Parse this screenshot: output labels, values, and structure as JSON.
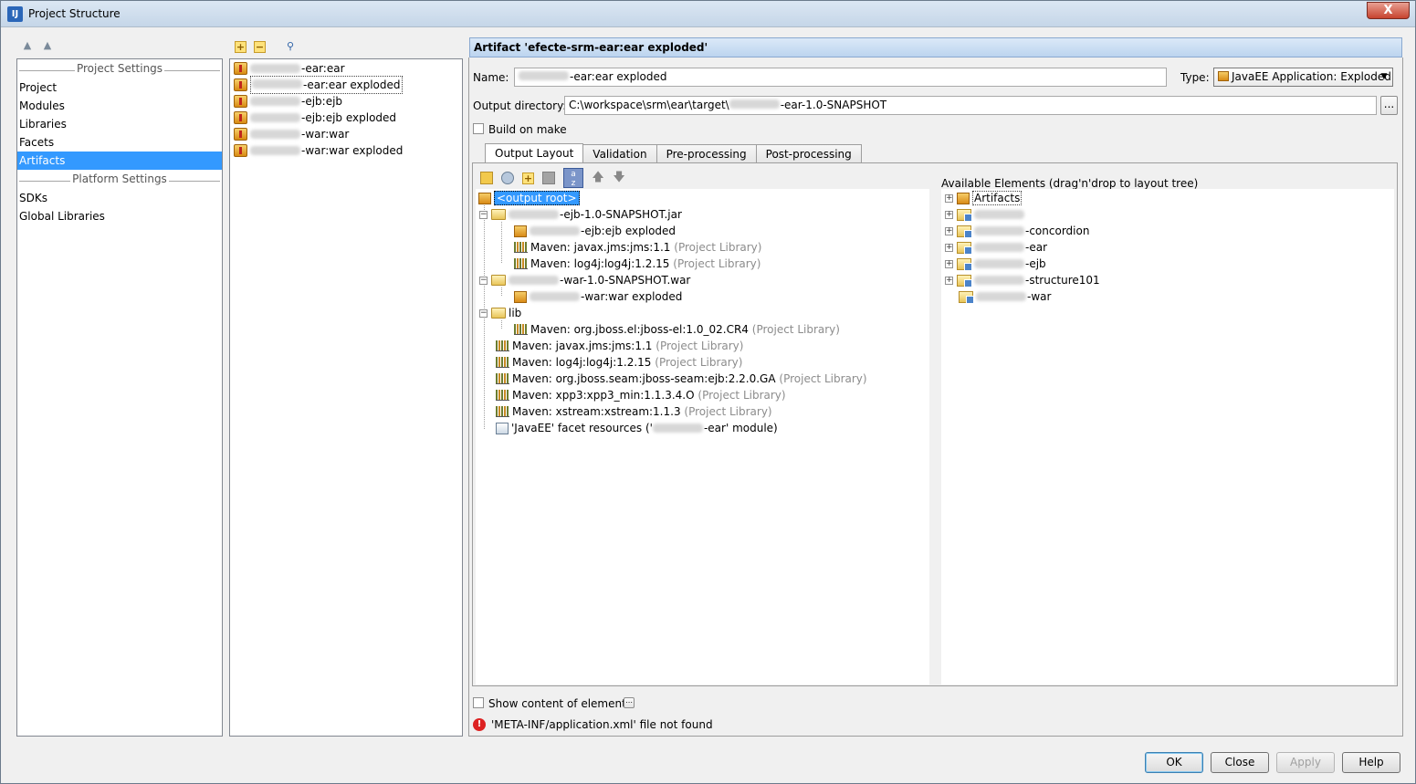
{
  "window": {
    "title": "Project Structure",
    "close_glyph": "X",
    "app_icon_letters": "IJ"
  },
  "nav": {
    "project_settings_label": "Project Settings",
    "project_items": [
      "Project",
      "Modules",
      "Libraries",
      "Facets",
      "Artifacts"
    ],
    "platform_settings_label": "Platform Settings",
    "platform_items": [
      "SDKs",
      "Global Libraries"
    ],
    "selected": "Artifacts"
  },
  "artifacts_list": [
    "-ear:ear",
    "-ear:ear exploded",
    "-ejb:ejb",
    "-ejb:ejb exploded",
    "-war:war",
    "-war:war exploded"
  ],
  "artifact": {
    "header": "Artifact 'efecte-srm-ear:ear exploded'",
    "name_label": "Name:",
    "name_value": "-ear:ear exploded",
    "type_label": "Type:",
    "type_value": "JavaEE Application: Exploded",
    "output_dir_label": "Output directory:",
    "output_dir_prefix": "C:\\workspace\\srm\\ear\\target\\",
    "output_dir_suffix": "-ear-1.0-SNAPSHOT",
    "browse_label": "...",
    "build_on_make_label": "Build on make"
  },
  "tabs": [
    "Output Layout",
    "Validation",
    "Pre-processing",
    "Post-processing"
  ],
  "layout_tree": {
    "root": "<output root>",
    "ejb_jar": "-ejb-1.0-SNAPSHOT.jar",
    "ejb_exploded": "-ejb:ejb exploded",
    "jms_lib": "Maven: javax.jms:jms:1.1",
    "log4j_lib": "Maven: log4j:log4j:1.2.15",
    "war_file": "-war-1.0-SNAPSHOT.war",
    "war_exploded": "-war:war exploded",
    "lib_folder": "lib",
    "jboss_el": "Maven: org.jboss.el:jboss-el:1.0_02.CR4",
    "seam": "Maven: org.jboss.seam:jboss-seam:ejb:2.2.0.GA",
    "xpp3": "Maven: xpp3:xpp3_min:1.1.3.4.O",
    "xstream": "Maven: xstream:xstream:1.1.3",
    "project_library": "(Project Library)",
    "facet_prefix": "'JavaEE' facet resources ('",
    "facet_suffix": "-ear' module)"
  },
  "available": {
    "title": "Available Elements (drag'n'drop to layout tree)",
    "artifacts": "Artifacts",
    "modules": [
      "-concordion",
      "-ear",
      "-ejb",
      "-structure101",
      "-war"
    ]
  },
  "show_content_label": "Show content of elements",
  "error_message": "'META-INF/application.xml' file not found",
  "buttons": {
    "ok": "OK",
    "close": "Close",
    "apply": "Apply",
    "help": "Help"
  }
}
